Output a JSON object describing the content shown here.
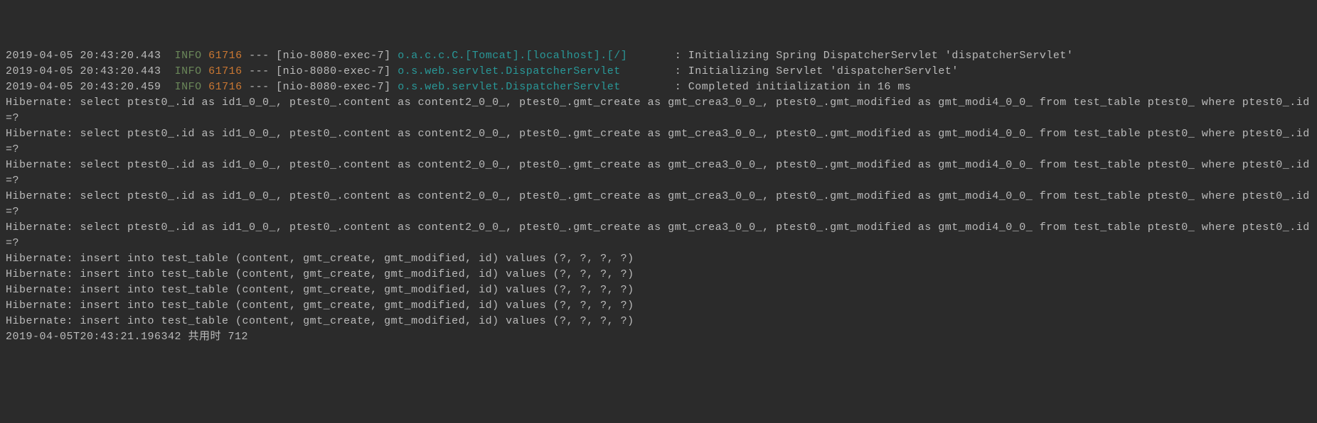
{
  "lines": [
    {
      "type": "spring",
      "ts": "2019-04-05 20:43:20.443",
      "level": "INFO",
      "pid": "61716",
      "dash": "---",
      "thread": "[nio-8080-exec-7]",
      "logger": "o.a.c.c.C.[Tomcat].[localhost].[/]      ",
      "colon": " : ",
      "msg": "Initializing Spring DispatcherServlet 'dispatcherServlet'"
    },
    {
      "type": "spring",
      "ts": "2019-04-05 20:43:20.443",
      "level": "INFO",
      "pid": "61716",
      "dash": "---",
      "thread": "[nio-8080-exec-7]",
      "logger": "o.s.web.servlet.DispatcherServlet       ",
      "colon": " : ",
      "msg": "Initializing Servlet 'dispatcherServlet'"
    },
    {
      "type": "spring",
      "ts": "2019-04-05 20:43:20.459",
      "level": "INFO",
      "pid": "61716",
      "dash": "---",
      "thread": "[nio-8080-exec-7]",
      "logger": "o.s.web.servlet.DispatcherServlet       ",
      "colon": " : ",
      "msg": "Completed initialization in 16 ms"
    },
    {
      "type": "plain",
      "text": "Hibernate: select ptest0_.id as id1_0_0_, ptest0_.content as content2_0_0_, ptest0_.gmt_create as gmt_crea3_0_0_, ptest0_.gmt_modified as gmt_modi4_0_0_ from test_table ptest0_ where ptest0_.id=?"
    },
    {
      "type": "plain",
      "text": "Hibernate: select ptest0_.id as id1_0_0_, ptest0_.content as content2_0_0_, ptest0_.gmt_create as gmt_crea3_0_0_, ptest0_.gmt_modified as gmt_modi4_0_0_ from test_table ptest0_ where ptest0_.id=?"
    },
    {
      "type": "plain",
      "text": "Hibernate: select ptest0_.id as id1_0_0_, ptest0_.content as content2_0_0_, ptest0_.gmt_create as gmt_crea3_0_0_, ptest0_.gmt_modified as gmt_modi4_0_0_ from test_table ptest0_ where ptest0_.id=?"
    },
    {
      "type": "plain",
      "text": "Hibernate: select ptest0_.id as id1_0_0_, ptest0_.content as content2_0_0_, ptest0_.gmt_create as gmt_crea3_0_0_, ptest0_.gmt_modified as gmt_modi4_0_0_ from test_table ptest0_ where ptest0_.id=?"
    },
    {
      "type": "plain",
      "text": "Hibernate: select ptest0_.id as id1_0_0_, ptest0_.content as content2_0_0_, ptest0_.gmt_create as gmt_crea3_0_0_, ptest0_.gmt_modified as gmt_modi4_0_0_ from test_table ptest0_ where ptest0_.id=?"
    },
    {
      "type": "plain",
      "text": "Hibernate: insert into test_table (content, gmt_create, gmt_modified, id) values (?, ?, ?, ?)"
    },
    {
      "type": "plain",
      "text": "Hibernate: insert into test_table (content, gmt_create, gmt_modified, id) values (?, ?, ?, ?)"
    },
    {
      "type": "plain",
      "text": "Hibernate: insert into test_table (content, gmt_create, gmt_modified, id) values (?, ?, ?, ?)"
    },
    {
      "type": "plain",
      "text": "Hibernate: insert into test_table (content, gmt_create, gmt_modified, id) values (?, ?, ?, ?)"
    },
    {
      "type": "plain",
      "text": "Hibernate: insert into test_table (content, gmt_create, gmt_modified, id) values (?, ?, ?, ?)"
    },
    {
      "type": "plain",
      "text": "2019-04-05T20:43:21.196342 共用时 712"
    }
  ]
}
